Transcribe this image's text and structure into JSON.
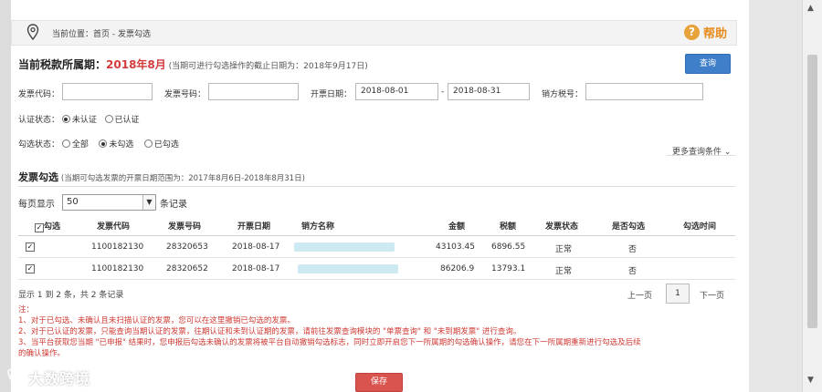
{
  "breadcrumb": {
    "label": "当前位置：",
    "home": "首页",
    "sep": " - ",
    "current": "发票勾选"
  },
  "help": {
    "icon": "?",
    "label": "帮助"
  },
  "period": {
    "label": "当前税款所属期：",
    "value": "2018年8月",
    "note": "(当期可进行勾选操作的截止日期为：2018年9月17日)"
  },
  "query_button": "查询",
  "filters": {
    "invoice_code_label": "发票代码：",
    "invoice_code_value": "",
    "invoice_number_label": "发票号码：",
    "invoice_number_value": "",
    "date_label": "开票日期：",
    "date_from": "2018-08-01",
    "date_sep": "-",
    "date_to": "2018-08-31",
    "seller_tax_label": "销方税号：",
    "seller_tax_value": "",
    "auth_status_label": "认证状态：",
    "auth_options": [
      "未认证",
      "已认证"
    ],
    "auth_selected": "未认证",
    "select_status_label": "勾选状态：",
    "select_options": [
      "全部",
      "未勾选",
      "已勾选"
    ],
    "select_selected": "未勾选",
    "more_conditions": "更多查询条件 ⌄"
  },
  "section": {
    "title": "发票勾选",
    "note": "(当期可勾选发票的开票日期范围为：2017年8月6日-2018年8月31日)"
  },
  "page_size": {
    "prefix": "每页显示",
    "value": "50",
    "suffix": "条记录"
  },
  "table": {
    "headers": [
      "勾选",
      "发票代码",
      "发票号码",
      "开票日期",
      "销方名称",
      "金额",
      "税额",
      "发票状态",
      "是否勾选",
      "勾选时间"
    ],
    "rows": [
      {
        "checked": true,
        "code": "1100182130",
        "number": "28320653",
        "date": "2018-08-17",
        "seller": "",
        "amount": "43103.45",
        "tax": "6896.55",
        "status": "正常",
        "selected": "否",
        "time": ""
      },
      {
        "checked": true,
        "code": "1100182130",
        "number": "28320652",
        "date": "2018-08-17",
        "seller": "",
        "amount": "86206.9",
        "tax": "13793.1",
        "status": "正常",
        "selected": "否",
        "time": ""
      }
    ]
  },
  "summary": "显示 1 到 2 条，共 2 条记录",
  "pagination": {
    "prev": "上一页",
    "current": "1",
    "next": "下一页"
  },
  "notes": [
    "注：",
    "1、对于已勾选、未确认且未扫描认证的发票，您可以在这里撤销已勾选的发票。",
    "2、对于已认证的发票，只能查询当期认证的发票，往期认证和未到认证期的发票，请前往发票查询模块的 \"单票查询\" 和 \"未到期发票\" 进行查询。",
    "3、当平台获取您当期 \"已申报\" 结果时，您申报后勾选未确认的发票将被平台自动撤销勾选标志，同时立即开启您下一所属期的勾选确认操作，请您在下一所属期重新进行勾选及后续",
    "的确认操作。"
  ],
  "save_button": "保存",
  "watermark": "大数跨境",
  "colors": {
    "accent_red": "#d23c3c",
    "query_blue": "#3f7fc9",
    "help_orange": "#e8a23a",
    "save_red": "#d9534f"
  }
}
